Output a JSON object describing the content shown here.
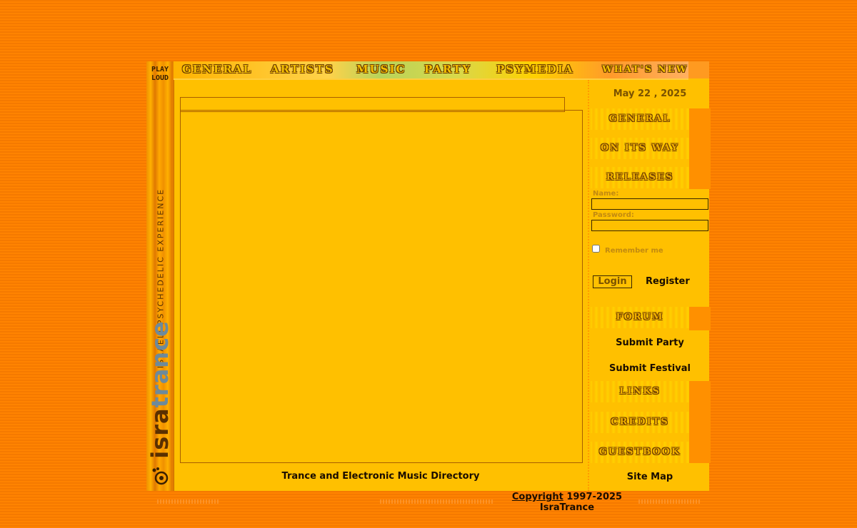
{
  "left_strip": {
    "play_loud": [
      "PLAY",
      "LOUD"
    ],
    "tagline": "ISRAELI PSYCHEDELIC EXPERIENCE",
    "logo_plain": "isra",
    "logo_accent": "trance"
  },
  "top_nav": {
    "items": [
      "GENERAL",
      "ARTISTS",
      "MUSIC",
      "PARTY",
      "PSYMEDIA",
      "WHAT'S NEW"
    ]
  },
  "sidebar": {
    "date": "May 22 , 2025",
    "buttons": [
      "GENERAL",
      "ON ITS WAY",
      "RELEASES"
    ],
    "login": {
      "name_label": "Name:",
      "name_value": "",
      "password_label": "Password:",
      "password_value": "",
      "remember_label": "Remember me",
      "login_button": "Login",
      "register_link": "Register"
    },
    "forum_button": "FORUM",
    "submit_party": "Submit Party",
    "submit_festival": "Submit Festival",
    "bottom_buttons": [
      "LINKS",
      "CREDITS",
      "GUESTBOOK"
    ],
    "site_map": "Site Map"
  },
  "main": {
    "footer_text": "Trance and Electronic Music Directory"
  },
  "copyright": {
    "link": "Copyright",
    "years": " 1997-2025",
    "owner": "IsraTrance"
  },
  "colors": {
    "background": "#ff8300",
    "panel": "#ffc000",
    "border": "#a85e00",
    "text_dark": "#1a0d00"
  }
}
